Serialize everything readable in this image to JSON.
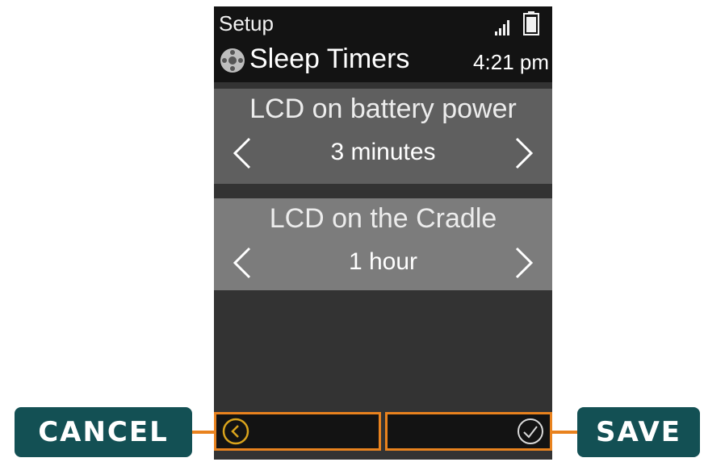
{
  "status_bar": {
    "setup_label": "Setup",
    "signal_icon": "signal-bars-icon",
    "battery_icon": "battery-icon"
  },
  "title_bar": {
    "icon": "steering-wheel-icon",
    "title": "Sleep Timers",
    "time": "4:21 pm"
  },
  "rows": [
    {
      "title": "LCD on battery power",
      "value": "3 minutes"
    },
    {
      "title": "LCD on the Cradle",
      "value": "1 hour"
    }
  ],
  "footer": {
    "back_icon": "chevron-left-circle-icon",
    "confirm_icon": "checkmark-circle-icon"
  },
  "callouts": {
    "cancel": "CANCEL",
    "save": "SAVE"
  },
  "colors": {
    "accent": "#e8821e",
    "callout_bg": "#135054",
    "screen_bg": "#333333",
    "bar_bg": "#131313"
  }
}
